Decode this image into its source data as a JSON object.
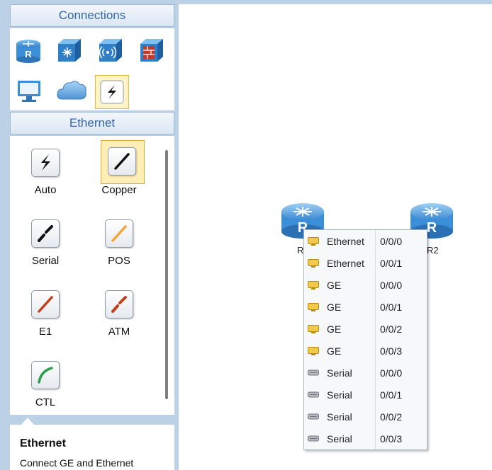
{
  "sidebar": {
    "connections_header": "Connections",
    "category_header": "Ethernet",
    "device_icons": [
      "router-icon",
      "switch-icon",
      "wireless-ap-icon",
      "firewall-icon",
      "pc-icon",
      "cloud-icon",
      "cable-icon"
    ],
    "cables": [
      {
        "label": "Auto",
        "icon": "auto-cable-icon",
        "color": "#111111"
      },
      {
        "label": "Copper",
        "icon": "copper-cable-icon",
        "color": "#111111"
      },
      {
        "label": "Serial",
        "icon": "serial-cable-icon",
        "color": "#111111"
      },
      {
        "label": "POS",
        "icon": "pos-cable-icon",
        "color": "#f4a43a"
      },
      {
        "label": "E1",
        "icon": "e1-cable-icon",
        "color": "#c0401e"
      },
      {
        "label": "ATM",
        "icon": "atm-cable-icon",
        "color": "#c0401e"
      },
      {
        "label": "CTL",
        "icon": "ctl-cable-icon",
        "color": "#2e9e4f"
      }
    ],
    "description": {
      "title": "Ethernet",
      "text": "Connect GE and Ethernet"
    }
  },
  "canvas": {
    "routers": [
      {
        "label": "R",
        "icon": "router-icon"
      },
      {
        "label": "R2",
        "icon": "router-icon"
      }
    ]
  },
  "port_menu": {
    "items": [
      {
        "name": "Ethernet",
        "port": "0/0/0",
        "icon": "ethernet-port-icon"
      },
      {
        "name": "Ethernet",
        "port": "0/0/1",
        "icon": "ethernet-port-icon"
      },
      {
        "name": "GE",
        "port": "0/0/0",
        "icon": "ethernet-port-icon"
      },
      {
        "name": "GE",
        "port": "0/0/1",
        "icon": "ethernet-port-icon"
      },
      {
        "name": "GE",
        "port": "0/0/2",
        "icon": "ethernet-port-icon"
      },
      {
        "name": "GE",
        "port": "0/0/3",
        "icon": "ethernet-port-icon"
      },
      {
        "name": "Serial",
        "port": "0/0/0",
        "icon": "serial-port-icon"
      },
      {
        "name": "Serial",
        "port": "0/0/1",
        "icon": "serial-port-icon"
      },
      {
        "name": "Serial",
        "port": "0/0/2",
        "icon": "serial-port-icon"
      },
      {
        "name": "Serial",
        "port": "0/0/3",
        "icon": "serial-port-icon"
      }
    ]
  },
  "colors": {
    "panel": "#bcd0e6",
    "header_text": "#3568a8",
    "router_blue": "#3a8fd8",
    "port_yellow": "#f2c94c",
    "port_grey": "#9aa0a6"
  }
}
